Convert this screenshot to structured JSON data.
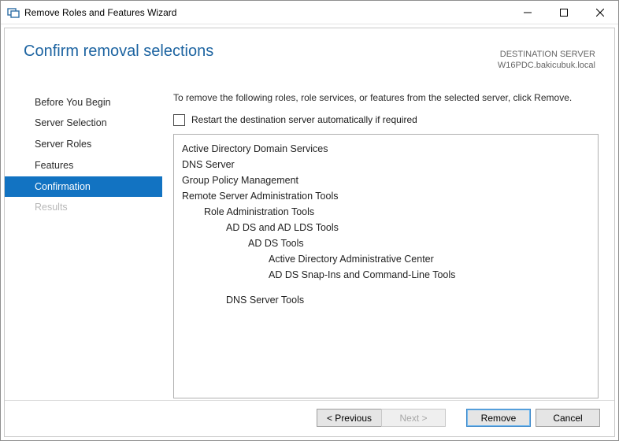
{
  "titlebar": {
    "title": "Remove Roles and Features Wizard"
  },
  "header": {
    "heading": "Confirm removal selections",
    "dest_label": "DESTINATION SERVER",
    "dest_server": "W16PDC.bakicubuk.local"
  },
  "sidebar": {
    "items": [
      {
        "label": "Before You Begin",
        "selected": false,
        "disabled": false
      },
      {
        "label": "Server Selection",
        "selected": false,
        "disabled": false
      },
      {
        "label": "Server Roles",
        "selected": false,
        "disabled": false
      },
      {
        "label": "Features",
        "selected": false,
        "disabled": false
      },
      {
        "label": "Confirmation",
        "selected": true,
        "disabled": false
      },
      {
        "label": "Results",
        "selected": false,
        "disabled": true
      }
    ]
  },
  "main": {
    "instruction": "To remove the following roles, role services, or features from the selected server, click Remove.",
    "restart_label": "Restart the destination server automatically if required",
    "restart_checked": false,
    "list": {
      "l0": "Active Directory Domain Services",
      "l1": "DNS Server",
      "l2": "Group Policy Management",
      "l3": "Remote Server Administration Tools",
      "l4": "Role Administration Tools",
      "l5": "AD DS and AD LDS Tools",
      "l6": "AD DS Tools",
      "l7": "Active Directory Administrative Center",
      "l8": "AD DS Snap-Ins and Command-Line Tools",
      "l9": "DNS Server Tools"
    }
  },
  "footer": {
    "previous": "< Previous",
    "next": "Next >",
    "remove": "Remove",
    "cancel": "Cancel"
  }
}
